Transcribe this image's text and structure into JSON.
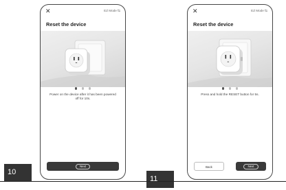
{
  "steps": [
    {
      "number": "10",
      "top_link": "EZ Mode",
      "title": "Reset the device",
      "instruction": "Power on the device after it has been powered off for 10s.",
      "next_label": "Next",
      "pager": {
        "count": 3,
        "active": 0
      }
    },
    {
      "number": "11",
      "top_link": "EZ Mode",
      "title": "Reset the device",
      "instruction": "Press and hold the RESET button for 5s.",
      "back_label": "Back",
      "next_label": "Next",
      "pager": {
        "count": 3,
        "active": 0
      }
    }
  ],
  "icons": {
    "close": "close-icon",
    "mode_switch": "swap-icon"
  },
  "colors": {
    "primary_button": "#3a3a3a",
    "illustration_bg": "#e6e6e6",
    "step_badge": "#333333"
  }
}
